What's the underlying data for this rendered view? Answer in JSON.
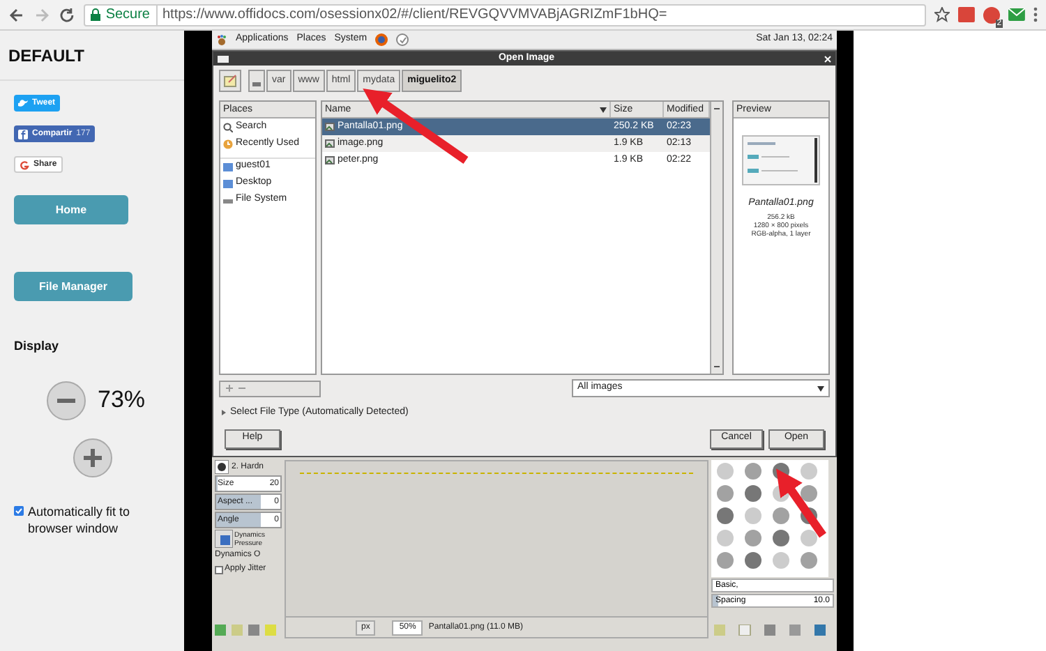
{
  "browser": {
    "secure_label": "Secure",
    "url": "https://www.offidocs.com/osessionx02/#/client/REVGQVVMVABjAGRIZmF1bHQ=",
    "extension_badge": "2"
  },
  "sidebar": {
    "title": "DEFAULT",
    "share_buttons": [
      {
        "kind": "twitter",
        "label": "Tweet"
      },
      {
        "kind": "facebook",
        "label": "Compartir",
        "count": "177"
      },
      {
        "kind": "google",
        "label": "Share"
      }
    ],
    "nav_buttons": [
      "Home",
      "File Manager"
    ],
    "display_heading": "Display",
    "zoom": "73%",
    "autofit": {
      "label": "Automatically fit to browser window",
      "checked": true
    }
  },
  "desktop_panel": {
    "menus": [
      "Applications",
      "Places",
      "System"
    ],
    "clock": "Sat Jan 13, 02:24"
  },
  "dialog": {
    "title": "Open Image",
    "path": [
      {
        "label": "var",
        "selected": false
      },
      {
        "label": "www",
        "selected": false
      },
      {
        "label": "html",
        "selected": false
      },
      {
        "label": "mydata",
        "selected": false
      },
      {
        "label": "miguelito2",
        "selected": true
      }
    ],
    "places_header": "Places",
    "places": [
      {
        "kind": "search",
        "label": "Search"
      },
      {
        "kind": "recent",
        "label": "Recently Used"
      },
      {
        "kind": "folder",
        "label": "guest01"
      },
      {
        "kind": "folder",
        "label": "Desktop"
      },
      {
        "kind": "drive",
        "label": "File System"
      }
    ],
    "columns": [
      "Name",
      "Size",
      "Modified"
    ],
    "files": [
      {
        "name": "Pantalla01.png",
        "size": "250.2 KB",
        "modified": "02:23",
        "selected": true
      },
      {
        "name": "image.png",
        "size": "1.9 KB",
        "modified": "02:13",
        "selected": false
      },
      {
        "name": "peter.png",
        "size": "1.9 KB",
        "modified": "02:22",
        "selected": false
      }
    ],
    "preview": {
      "header": "Preview",
      "file": "Pantalla01.png",
      "lines": [
        "256.2 kB",
        "1280 × 800 pixels",
        "RGB-alpha, 1 layer"
      ]
    },
    "filter": "All images",
    "expander": "Select File Type (Automatically Detected)",
    "buttons": {
      "help": "Help",
      "cancel": "Cancel",
      "open": "Open"
    }
  },
  "gimp": {
    "brush": "2. Hardn",
    "options": [
      {
        "label": "Size",
        "value": "20",
        "level": 0.02
      },
      {
        "label": "Aspect ...",
        "value": "0",
        "level": 0.7
      },
      {
        "label": "Angle",
        "value": "0",
        "level": 0.7
      }
    ],
    "dynamics": [
      "Dynamics",
      "Pressure"
    ],
    "dynamics_options": "Dynamics O",
    "apply_jitter": {
      "label": "Apply Jitter",
      "checked": false
    },
    "unit": "px",
    "zoom": "50%",
    "status": "Pantalla01.png (11.0 MB)",
    "brush_tag": "Basic,",
    "spacing": {
      "label": "Spacing",
      "value": "10.0",
      "level": 0.05
    }
  }
}
